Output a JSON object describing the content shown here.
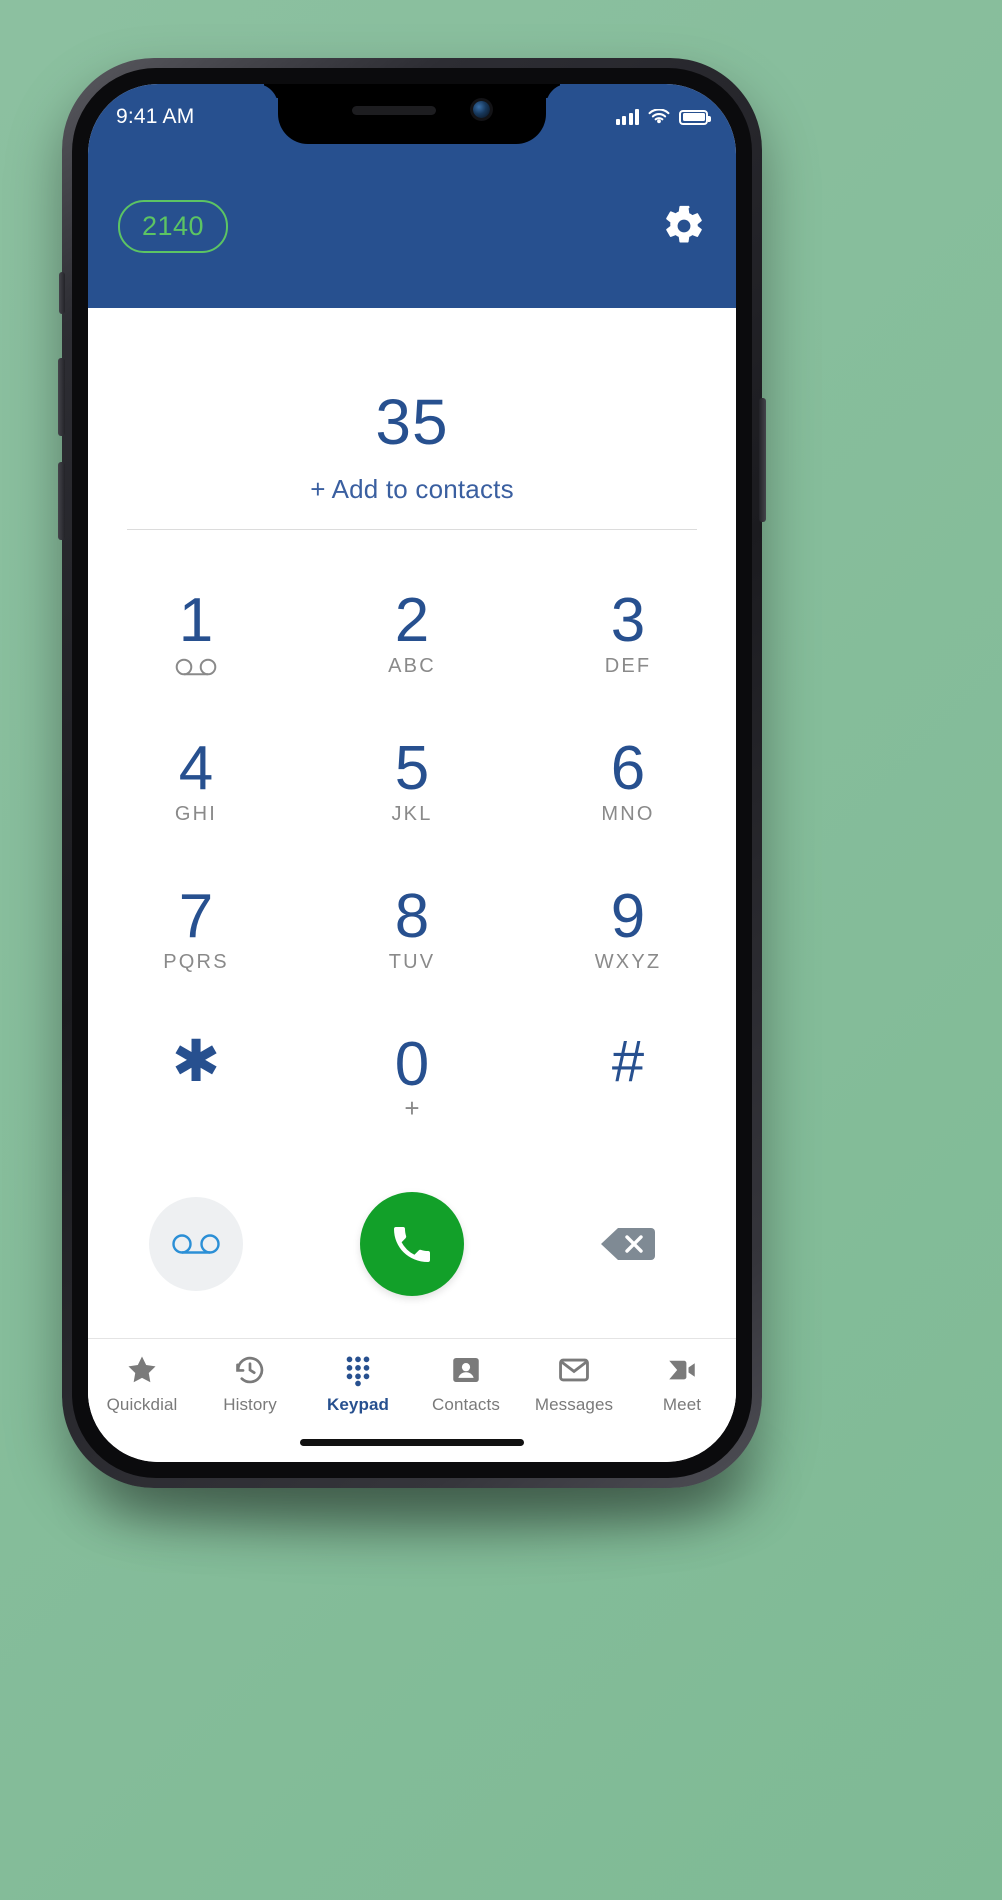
{
  "status_bar": {
    "time": "9:41 AM",
    "signal_icon": "cellular-signal-icon",
    "wifi_icon": "wifi-icon",
    "battery_icon": "battery-full-icon"
  },
  "header": {
    "extension_badge": "2140",
    "settings_icon": "gear-icon",
    "background_color": "#27508F",
    "badge_color": "#5CC463"
  },
  "display": {
    "dialed_number": "35",
    "add_to_contacts": "+ Add to contacts",
    "number_color": "#27508F",
    "link_color": "#3A5FA0"
  },
  "keypad": {
    "keys": [
      {
        "digit": "1",
        "letters": "",
        "icon": "voicemail-icon"
      },
      {
        "digit": "2",
        "letters": "ABC",
        "icon": ""
      },
      {
        "digit": "3",
        "letters": "DEF",
        "icon": ""
      },
      {
        "digit": "4",
        "letters": "GHI",
        "icon": ""
      },
      {
        "digit": "5",
        "letters": "JKL",
        "icon": ""
      },
      {
        "digit": "6",
        "letters": "MNO",
        "icon": ""
      },
      {
        "digit": "7",
        "letters": "PQRS",
        "icon": ""
      },
      {
        "digit": "8",
        "letters": "TUV",
        "icon": ""
      },
      {
        "digit": "9",
        "letters": "WXYZ",
        "icon": ""
      },
      {
        "digit": "✱",
        "letters": "",
        "icon": ""
      },
      {
        "digit": "0",
        "letters": "+",
        "icon": ""
      },
      {
        "digit": "#",
        "letters": "",
        "icon": ""
      }
    ]
  },
  "actions": {
    "voicemail_icon": "voicemail-icon",
    "call_icon": "phone-handset-icon",
    "backspace_icon": "backspace-icon",
    "call_color": "#12A029",
    "voicemail_bg": "#EEF0F2",
    "backspace_color": "#7F8A94"
  },
  "tabbar": {
    "tabs": [
      {
        "label": "Quickdial",
        "icon": "star-icon",
        "active": false
      },
      {
        "label": "History",
        "icon": "clock-history-icon",
        "active": false
      },
      {
        "label": "Keypad",
        "icon": "keypad-dots-icon",
        "active": true
      },
      {
        "label": "Contacts",
        "icon": "contact-card-icon",
        "active": false
      },
      {
        "label": "Messages",
        "icon": "envelope-icon",
        "active": false
      },
      {
        "label": "Meet",
        "icon": "video-meet-icon",
        "active": false
      }
    ],
    "active_color": "#27508F",
    "inactive_color": "#7A7A7A"
  }
}
